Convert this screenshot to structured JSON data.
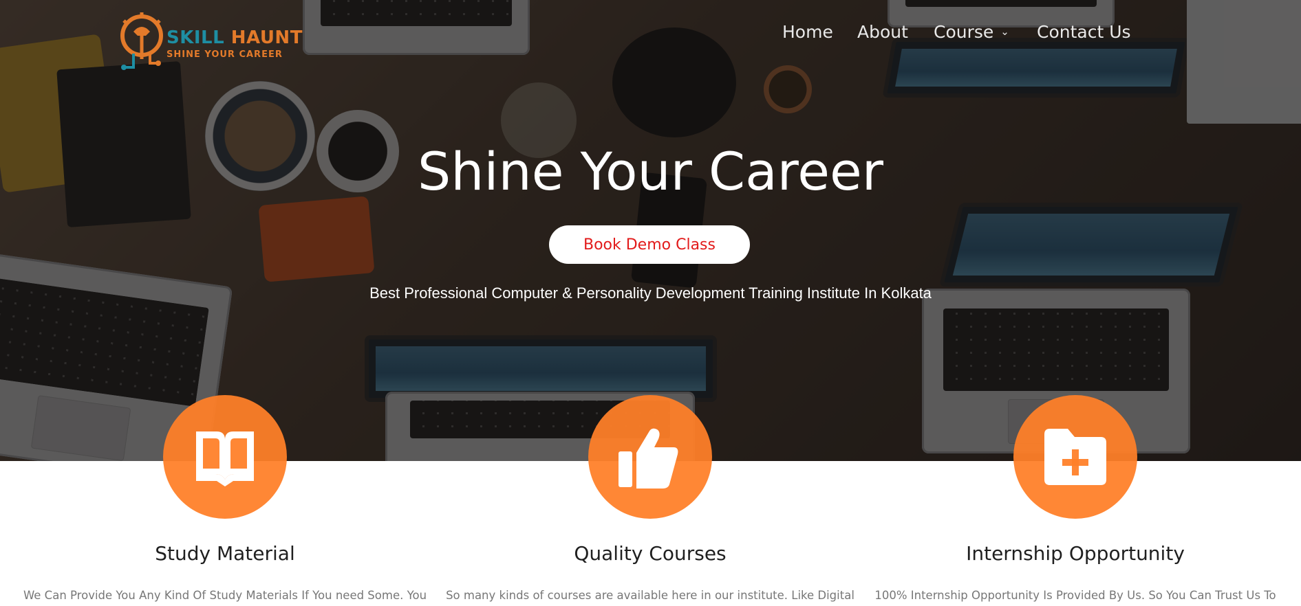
{
  "brand": {
    "name_part1": "SKILL",
    "name_part2": " HAUNT",
    "tagline": "SHINE YOUR CAREER"
  },
  "nav": {
    "items": [
      {
        "label": "Home"
      },
      {
        "label": "About"
      },
      {
        "label": "Course",
        "has_dropdown": true
      },
      {
        "label": "Contact Us"
      }
    ]
  },
  "hero": {
    "title": "Shine Your Career",
    "cta_label": "Book Demo Class",
    "subtitle": "Best Professional Computer & Personality Development Training Institute In Kolkata"
  },
  "features": [
    {
      "icon": "open-book-icon",
      "title": "Study Material",
      "text": "We Can Provide You Any Kind Of Study Materials If You need Some. You"
    },
    {
      "icon": "thumbs-up-icon",
      "title": "Quality Courses",
      "text": "So many kinds of courses are available here in our institute. Like Digital"
    },
    {
      "icon": "folder-plus-icon",
      "title": "Internship Opportunity",
      "text": "100% Internship Opportunity Is Provided By Us. So You Can Trust Us To"
    }
  ],
  "colors": {
    "accent_orange": "#ff8028",
    "brand_teal": "#1e8ea3",
    "cta_text": "#e21a1a"
  }
}
